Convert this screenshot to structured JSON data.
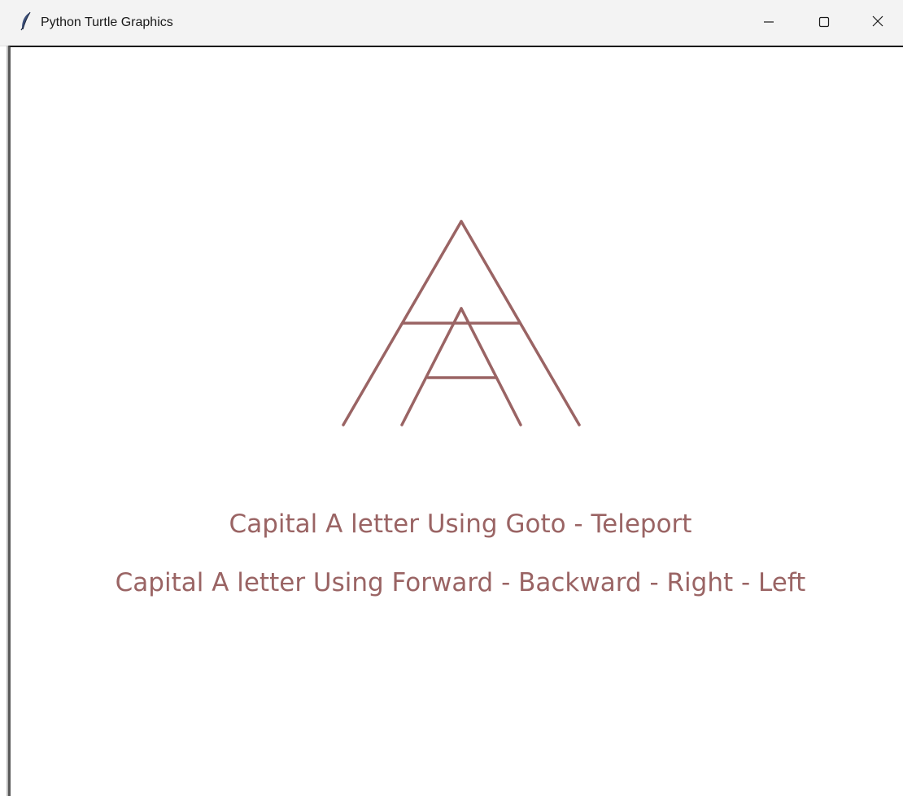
{
  "window": {
    "title": "Python Turtle Graphics",
    "icons": {
      "app": "feather-icon",
      "minimize": "minimize-icon",
      "maximize": "maximize-icon",
      "close": "close-icon"
    }
  },
  "canvas": {
    "background": "#ffffff",
    "pen_color": "#9a6464",
    "text_color": "#9a6464",
    "lines": [
      "Capital A letter Using Goto - Teleport",
      "Capital A letter Using Forward - Backward - Right - Left"
    ]
  }
}
